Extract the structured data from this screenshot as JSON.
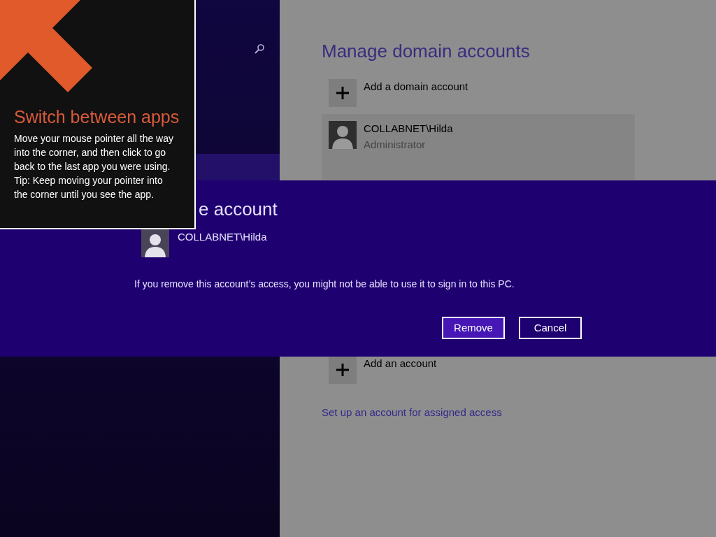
{
  "settings": {
    "heading": "Manage domain accounts",
    "add_domain_account": "Add a domain account",
    "accounts": [
      {
        "name": "COLLABNET\\Hilda",
        "role": "Administrator"
      }
    ],
    "add_account": "Add an account",
    "assigned_access_link": "Set up an account for assigned access"
  },
  "dialog": {
    "title": "e account",
    "account": "COLLABNET\\Hilda",
    "message": "If you remove this account’s access, you might not be able to use it to sign in to this PC.",
    "buttons": [
      {
        "label": "Remove",
        "kind": "primary"
      },
      {
        "label": "Cancel",
        "kind": "secondary"
      }
    ]
  },
  "tip": {
    "title": "Switch between apps",
    "body": "Move your mouse pointer all the way into the corner, and then click to go back to the last app you were using.",
    "hint": "Tip: Keep moving your pointer into the corner until you see the app."
  }
}
